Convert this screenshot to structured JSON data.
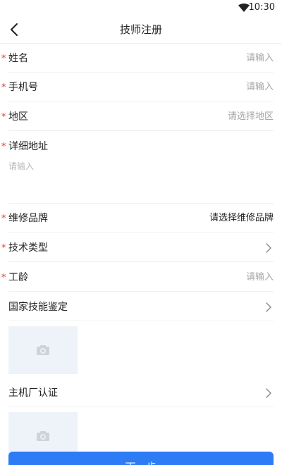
{
  "status_bar": {
    "time": "10:30",
    "wifi_icon": "wifi-icon"
  },
  "nav": {
    "title": "技师注册",
    "back_icon": "back-chevron-icon"
  },
  "form": {
    "required_mark": "*",
    "name": {
      "label": "姓名",
      "placeholder": "请输入"
    },
    "phone": {
      "label": "手机号",
      "placeholder": "请输入"
    },
    "region": {
      "label": "地区",
      "value": "请选择地区"
    },
    "address": {
      "label": "详细地址",
      "placeholder": "请输入"
    },
    "brand": {
      "label": "维修品牌",
      "value": "请选择维修品牌"
    },
    "tech_type": {
      "label": "技术类型"
    },
    "seniority": {
      "label": "工龄",
      "placeholder": "请输入"
    },
    "national_cert": {
      "label": "国家技能鉴定"
    },
    "oem_cert": {
      "label": "主机厂认证"
    }
  },
  "icons": {
    "chevron": "chevron-right-icon",
    "camera": "camera-icon"
  },
  "colors": {
    "primary": "#2d7cf6",
    "required": "#e33333",
    "placeholder": "#a5a5a5",
    "upload_bg": "#eef3f9"
  },
  "footer": {
    "next_label": "下一步"
  }
}
